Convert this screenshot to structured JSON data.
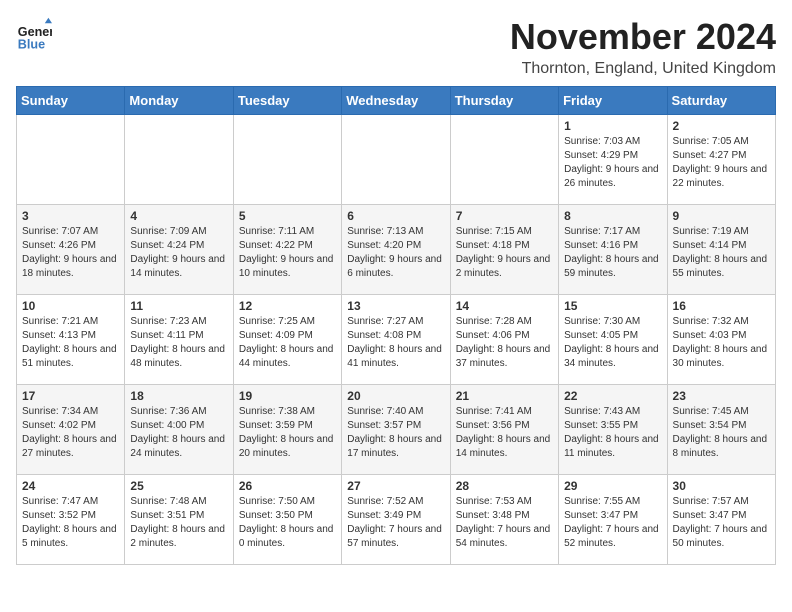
{
  "header": {
    "logo_text_top": "General",
    "logo_text_bottom": "Blue",
    "month": "November 2024",
    "location": "Thornton, England, United Kingdom"
  },
  "days_of_week": [
    "Sunday",
    "Monday",
    "Tuesday",
    "Wednesday",
    "Thursday",
    "Friday",
    "Saturday"
  ],
  "weeks": [
    [
      {
        "day": "",
        "info": ""
      },
      {
        "day": "",
        "info": ""
      },
      {
        "day": "",
        "info": ""
      },
      {
        "day": "",
        "info": ""
      },
      {
        "day": "",
        "info": ""
      },
      {
        "day": "1",
        "info": "Sunrise: 7:03 AM\nSunset: 4:29 PM\nDaylight: 9 hours and 26 minutes."
      },
      {
        "day": "2",
        "info": "Sunrise: 7:05 AM\nSunset: 4:27 PM\nDaylight: 9 hours and 22 minutes."
      }
    ],
    [
      {
        "day": "3",
        "info": "Sunrise: 7:07 AM\nSunset: 4:26 PM\nDaylight: 9 hours and 18 minutes."
      },
      {
        "day": "4",
        "info": "Sunrise: 7:09 AM\nSunset: 4:24 PM\nDaylight: 9 hours and 14 minutes."
      },
      {
        "day": "5",
        "info": "Sunrise: 7:11 AM\nSunset: 4:22 PM\nDaylight: 9 hours and 10 minutes."
      },
      {
        "day": "6",
        "info": "Sunrise: 7:13 AM\nSunset: 4:20 PM\nDaylight: 9 hours and 6 minutes."
      },
      {
        "day": "7",
        "info": "Sunrise: 7:15 AM\nSunset: 4:18 PM\nDaylight: 9 hours and 2 minutes."
      },
      {
        "day": "8",
        "info": "Sunrise: 7:17 AM\nSunset: 4:16 PM\nDaylight: 8 hours and 59 minutes."
      },
      {
        "day": "9",
        "info": "Sunrise: 7:19 AM\nSunset: 4:14 PM\nDaylight: 8 hours and 55 minutes."
      }
    ],
    [
      {
        "day": "10",
        "info": "Sunrise: 7:21 AM\nSunset: 4:13 PM\nDaylight: 8 hours and 51 minutes."
      },
      {
        "day": "11",
        "info": "Sunrise: 7:23 AM\nSunset: 4:11 PM\nDaylight: 8 hours and 48 minutes."
      },
      {
        "day": "12",
        "info": "Sunrise: 7:25 AM\nSunset: 4:09 PM\nDaylight: 8 hours and 44 minutes."
      },
      {
        "day": "13",
        "info": "Sunrise: 7:27 AM\nSunset: 4:08 PM\nDaylight: 8 hours and 41 minutes."
      },
      {
        "day": "14",
        "info": "Sunrise: 7:28 AM\nSunset: 4:06 PM\nDaylight: 8 hours and 37 minutes."
      },
      {
        "day": "15",
        "info": "Sunrise: 7:30 AM\nSunset: 4:05 PM\nDaylight: 8 hours and 34 minutes."
      },
      {
        "day": "16",
        "info": "Sunrise: 7:32 AM\nSunset: 4:03 PM\nDaylight: 8 hours and 30 minutes."
      }
    ],
    [
      {
        "day": "17",
        "info": "Sunrise: 7:34 AM\nSunset: 4:02 PM\nDaylight: 8 hours and 27 minutes."
      },
      {
        "day": "18",
        "info": "Sunrise: 7:36 AM\nSunset: 4:00 PM\nDaylight: 8 hours and 24 minutes."
      },
      {
        "day": "19",
        "info": "Sunrise: 7:38 AM\nSunset: 3:59 PM\nDaylight: 8 hours and 20 minutes."
      },
      {
        "day": "20",
        "info": "Sunrise: 7:40 AM\nSunset: 3:57 PM\nDaylight: 8 hours and 17 minutes."
      },
      {
        "day": "21",
        "info": "Sunrise: 7:41 AM\nSunset: 3:56 PM\nDaylight: 8 hours and 14 minutes."
      },
      {
        "day": "22",
        "info": "Sunrise: 7:43 AM\nSunset: 3:55 PM\nDaylight: 8 hours and 11 minutes."
      },
      {
        "day": "23",
        "info": "Sunrise: 7:45 AM\nSunset: 3:54 PM\nDaylight: 8 hours and 8 minutes."
      }
    ],
    [
      {
        "day": "24",
        "info": "Sunrise: 7:47 AM\nSunset: 3:52 PM\nDaylight: 8 hours and 5 minutes."
      },
      {
        "day": "25",
        "info": "Sunrise: 7:48 AM\nSunset: 3:51 PM\nDaylight: 8 hours and 2 minutes."
      },
      {
        "day": "26",
        "info": "Sunrise: 7:50 AM\nSunset: 3:50 PM\nDaylight: 8 hours and 0 minutes."
      },
      {
        "day": "27",
        "info": "Sunrise: 7:52 AM\nSunset: 3:49 PM\nDaylight: 7 hours and 57 minutes."
      },
      {
        "day": "28",
        "info": "Sunrise: 7:53 AM\nSunset: 3:48 PM\nDaylight: 7 hours and 54 minutes."
      },
      {
        "day": "29",
        "info": "Sunrise: 7:55 AM\nSunset: 3:47 PM\nDaylight: 7 hours and 52 minutes."
      },
      {
        "day": "30",
        "info": "Sunrise: 7:57 AM\nSunset: 3:47 PM\nDaylight: 7 hours and 50 minutes."
      }
    ]
  ]
}
